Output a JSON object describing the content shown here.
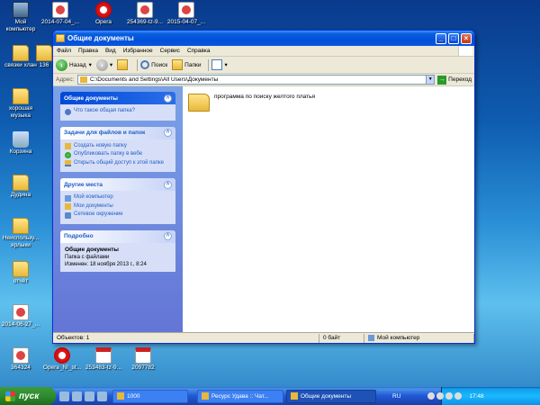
{
  "desktop": {
    "icons": [
      {
        "label": "Мой компьютер",
        "type": "pc"
      },
      {
        "label": "2014-07-04_...",
        "type": "png"
      },
      {
        "label": "Opera",
        "type": "opera"
      },
      {
        "label": "254369-tz-9...",
        "type": "png"
      },
      {
        "label": "2015-04-07_...",
        "type": "png"
      },
      {
        "label": "связки хлан",
        "type": "folder"
      },
      {
        "label": "136",
        "type": "folder"
      },
      {
        "label": "хорошая музыка",
        "type": "folder"
      },
      {
        "label": "Корзина",
        "type": "bin"
      },
      {
        "label": "Дудина",
        "type": "folder"
      },
      {
        "label": "Неиспользу... ярлыки",
        "type": "folder"
      },
      {
        "label": "отчёт",
        "type": "folder"
      },
      {
        "label": "2014-06-27_...",
        "type": "png"
      },
      {
        "label": "364324",
        "type": "png"
      },
      {
        "label": "Opera_NI_st...",
        "type": "opera"
      },
      {
        "label": "253483-tz-9...",
        "type": "pdf"
      },
      {
        "label": "2097782",
        "type": "pdf"
      }
    ]
  },
  "window": {
    "title": "Общие документы",
    "menu": [
      "Файл",
      "Правка",
      "Вид",
      "Избранное",
      "Сервис",
      "Справка"
    ],
    "toolbar": {
      "back_label": "Назад",
      "search_label": "Поиск",
      "folders_label": "Папки"
    },
    "address": {
      "label": "Адрес:",
      "value": "C:\\Documents and Settings\\All Users\\Документы",
      "go_label": "Переход"
    },
    "taskpane": {
      "panel1": {
        "title": "Общие документы",
        "links": [
          "Что такое общая папка?"
        ]
      },
      "panel2": {
        "title": "Задачи для файлов и папок",
        "links": [
          "Создать новую папку",
          "Опубликовать папку в вебе",
          "Открыть общий доступ к этой папке"
        ]
      },
      "panel3": {
        "title": "Другие места",
        "links": [
          "Мой компьютер",
          "Мои документы",
          "Сетевое окружение"
        ]
      },
      "panel4": {
        "title": "Подробно",
        "detail_title": "Общие документы",
        "detail_type": "Папка с файлами",
        "detail_modified": "Изменен: 18 ноября 2013 г., 8:24"
      }
    },
    "files": [
      {
        "name": "программа по поиску желтого платья"
      }
    ],
    "status": {
      "objects": "Объектов: 1",
      "size": "0 байт",
      "location": "Мой компьютер"
    }
  },
  "taskbar": {
    "start_label": "пуск",
    "tasks": [
      "1000",
      "Ресурс Удава :: Чат...",
      "Общие документы"
    ],
    "language": "RU",
    "clock": "17:48"
  }
}
